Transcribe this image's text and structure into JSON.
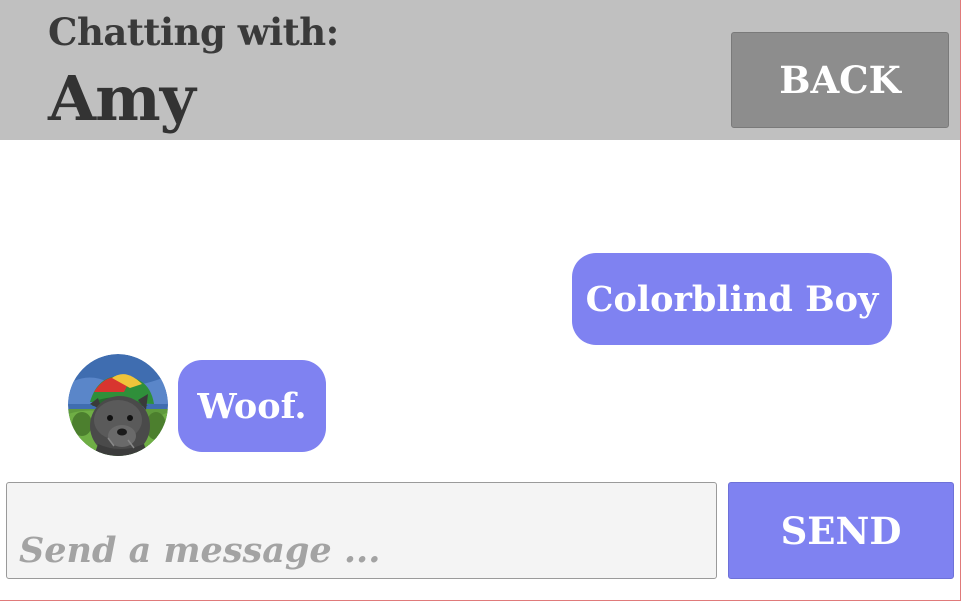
{
  "header": {
    "subtitle": "Chatting with:",
    "contact_name": "Amy",
    "back_label": "BACK"
  },
  "messages": [
    {
      "text": "Colorblind Boy",
      "side": "right"
    },
    {
      "text": "Woof.",
      "side": "left",
      "avatar": "dog-avatar-image"
    }
  ],
  "composer": {
    "placeholder": "Send a message ...",
    "value": "",
    "send_label": "SEND"
  },
  "colors": {
    "header_bg": "#c0c0c0",
    "back_button_bg": "#8d8d8d",
    "bubble_bg": "#7f82f1",
    "send_button_bg": "#7f82f1",
    "input_bg": "#f4f4f4"
  }
}
